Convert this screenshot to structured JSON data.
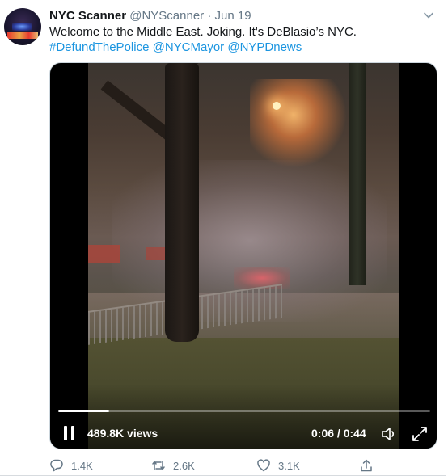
{
  "tweet": {
    "author_name": "NYC Scanner",
    "author_handle": "@NYScanner",
    "separator": "·",
    "date": "Jun 19",
    "text_plain": "Welcome to the Middle East. Joking. It's DeBlasio’s NYC.",
    "hashtag": "#DefundThePolice",
    "mention_1": "@NYCMayor",
    "mention_2": "@NYPDnews"
  },
  "video": {
    "views": "489.8K views",
    "time": "0:06 / 0:44",
    "progress": 0.136
  },
  "actions": {
    "replies": "1.4K",
    "retweets": "2.6K",
    "likes": "3.1K"
  },
  "colors": {
    "link": "#1b95e0",
    "muted": "#657786"
  },
  "icons": {
    "avatar": "avatar",
    "menu": "chevron-down-icon",
    "pause": "pause-icon",
    "volume": "volume-icon",
    "fullscreen": "fullscreen-icon",
    "reply": "reply-icon",
    "retweet": "retweet-icon",
    "like": "heart-icon",
    "share": "share-icon"
  }
}
